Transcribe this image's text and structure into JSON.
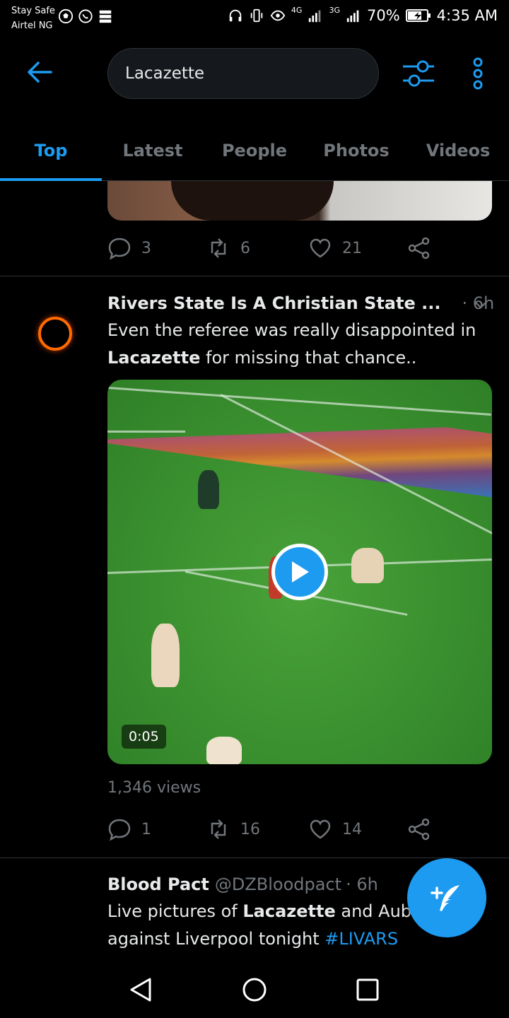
{
  "status_bar": {
    "carrier_line1": "Stay Safe",
    "carrier_line2": "Airtel NG",
    "net1": "4G",
    "net2": "3G",
    "battery": "70%",
    "time": "4:35 AM"
  },
  "header": {
    "search_value": "Lacazette"
  },
  "tabs": [
    {
      "label": "Top",
      "active": true
    },
    {
      "label": "Latest"
    },
    {
      "label": "People"
    },
    {
      "label": "Photos"
    },
    {
      "label": "Videos"
    }
  ],
  "tweet1": {
    "replies": "3",
    "retweets": "6",
    "likes": "21"
  },
  "tweet2": {
    "name": "Rivers State Is A Christian State ...",
    "time": "· 6h",
    "text_before": "Even the referee was really disappointed in ",
    "text_bold": "Lacazette",
    "text_after": " for missing that chance..",
    "video_duration": "0:05",
    "views": "1,346 views",
    "replies": "1",
    "retweets": "16",
    "likes": "14"
  },
  "tweet3": {
    "name": "Blood Pact",
    "handle": "@DZBloodpact",
    "time": "· 6h",
    "text_part1": "Live pictures of ",
    "text_bold": "Lacazette",
    "text_part2": " and Auba",
    "text_line2": "against Liverpool tonight ",
    "hashtag": "#LIVARS"
  },
  "colors": {
    "accent": "#1d9bf0",
    "muted": "#71767b",
    "background": "#000000"
  }
}
